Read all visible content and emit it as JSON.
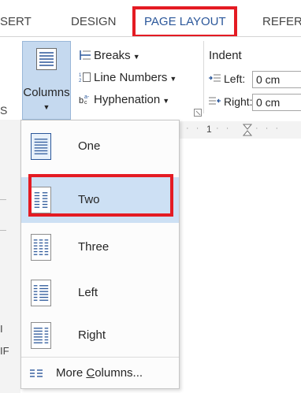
{
  "ribbon_tabs": {
    "insert_partial": "SERT",
    "design": "DESIGN",
    "page_layout": "PAGE LAYOUT",
    "references_partial": "REFERE"
  },
  "page_setup": {
    "columns_label": "Columns",
    "breaks_label": "Breaks",
    "line_numbers_label": "Line Numbers",
    "hyphenation_label": "Hyphenation",
    "group_label_partial": "S"
  },
  "paragraph": {
    "indent_label": "Indent",
    "left_label": "Left:",
    "right_label": "Right:",
    "left_value": "0 cm",
    "right_value": "0 cm"
  },
  "ruler": {
    "mark": "1"
  },
  "columns_menu": {
    "items": [
      {
        "label": "One"
      },
      {
        "label": "Two"
      },
      {
        "label": "Three"
      },
      {
        "label": "Left"
      },
      {
        "label": "Right"
      }
    ],
    "more_prefix": "More ",
    "more_accel": "C",
    "more_suffix": "olumns..."
  },
  "side_letters": {
    "a": "I",
    "b": "IF"
  },
  "colors": {
    "accent": "#2b579a",
    "highlight": "#e41b23",
    "hover": "#cde0f4"
  }
}
